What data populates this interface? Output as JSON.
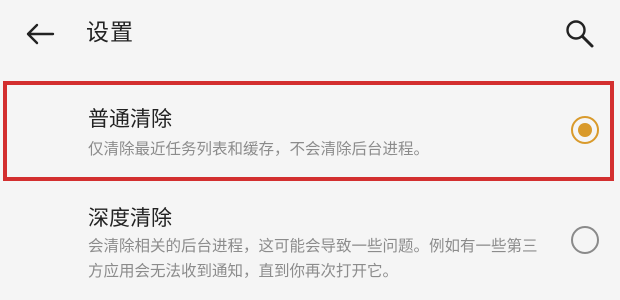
{
  "header": {
    "title": "设置",
    "back_icon": "arrow-left-icon",
    "search_icon": "search-icon"
  },
  "options": [
    {
      "title": "普通清除",
      "description": "仅清除最近任务列表和缓存，不会清除后台进程。",
      "selected": true
    },
    {
      "title": "深度清除",
      "description": "会清除相关的后台进程，这可能会导致一些问题。例如有一些第三方应用会无法收到通知，直到你再次打开它。",
      "selected": false
    }
  ],
  "colors": {
    "accent": "#d99a2b",
    "highlight": "#d32f2f",
    "background": "#f5f5f5",
    "secondary_text": "#8c8c8c"
  }
}
